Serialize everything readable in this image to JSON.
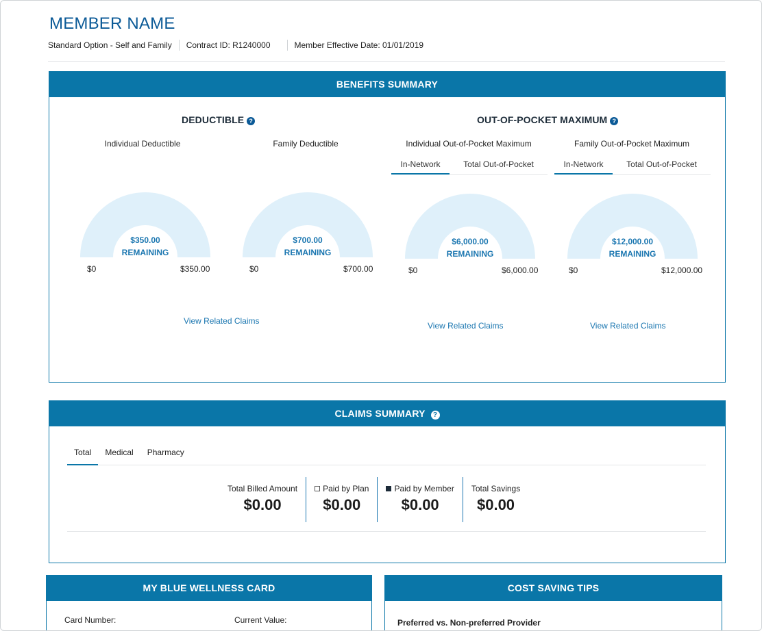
{
  "member": {
    "name": "MEMBER NAME",
    "plan": "Standard Option - Self and Family",
    "contract": "Contract ID: R1240000",
    "effective_date": "Member Effective Date: 01/01/2019"
  },
  "benefits": {
    "title": "BENEFITS SUMMARY",
    "deductible": {
      "title": "DEDUCTIBLE",
      "individual": {
        "label": "Individual Deductible",
        "amount": "$350.00",
        "remaining_label": "REMAINING",
        "min": "$0",
        "max": "$350.00",
        "fraction_used": 0
      },
      "family": {
        "label": "Family Deductible",
        "amount": "$700.00",
        "remaining_label": "REMAINING",
        "min": "$0",
        "max": "$700.00",
        "fraction_used": 0
      },
      "link": "View Related Claims"
    },
    "oop": {
      "title": "OUT-OF-POCKET MAXIMUM",
      "individual": {
        "label": "Individual Out-of-Pocket Maximum",
        "tabs": [
          "In-Network",
          "Total Out-of-Pocket"
        ],
        "amount": "$6,000.00",
        "remaining_label": "REMAINING",
        "min": "$0",
        "max": "$6,000.00",
        "link": "View Related Claims",
        "fraction_used": 0
      },
      "family": {
        "label": "Family Out-of-Pocket Maximum",
        "tabs": [
          "In-Network",
          "Total Out-of-Pocket"
        ],
        "amount": "$12,000.00",
        "remaining_label": "REMAINING",
        "min": "$0",
        "max": "$12,000.00",
        "link": "View Related Claims",
        "fraction_used": 0
      }
    }
  },
  "claims": {
    "title": "CLAIMS SUMMARY",
    "tabs": [
      "Total",
      "Medical",
      "Pharmacy"
    ],
    "stats": [
      {
        "label": "Total Billed Amount",
        "value": "$0.00"
      },
      {
        "label": "Paid by Plan",
        "value": "$0.00"
      },
      {
        "label": "Paid by Member",
        "value": "$0.00"
      },
      {
        "label": "Total Savings",
        "value": "$0.00"
      }
    ]
  },
  "wellness": {
    "title": "MY BLUE WELLNESS CARD",
    "card_number_label": "Card Number:",
    "current_value_label": "Current Value:"
  },
  "tips": {
    "title": "COST SAVING TIPS",
    "first_tip": "Preferred vs. Non-preferred Provider"
  },
  "colors": {
    "brand": "#0a76a8",
    "gauge_track": "#dff0fa",
    "link": "#1a76b0",
    "name": "#0b5a97"
  }
}
